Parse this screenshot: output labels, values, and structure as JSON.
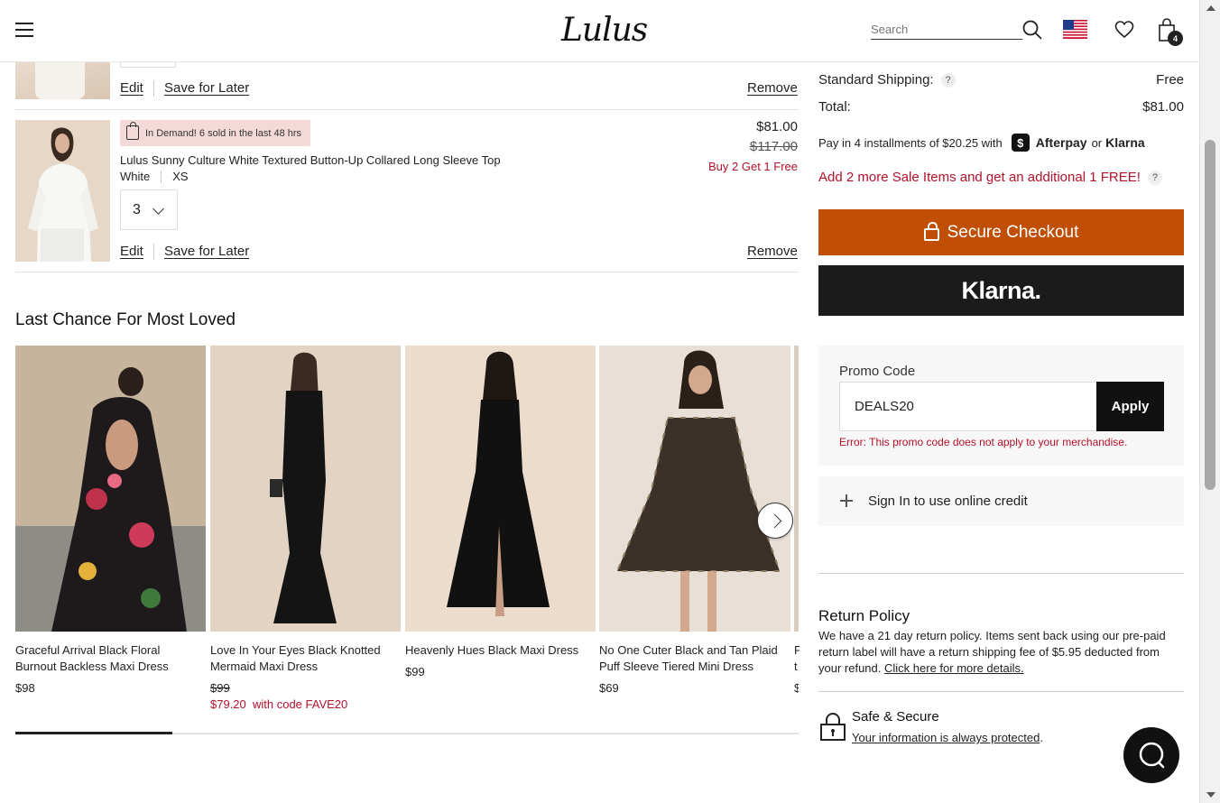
{
  "header": {
    "logo": "Lulus",
    "search_placeholder": "Search",
    "cart_count": "4"
  },
  "cart": {
    "item1": {
      "edit": "Edit",
      "save_for_later": "Save for Later",
      "remove": "Remove"
    },
    "item2": {
      "badge": "In Demand! 6 sold in the last 48 hrs",
      "name": "Lulus Sunny Culture White Textured Button-Up Collared Long Sleeve Top",
      "color": "White",
      "size": "XS",
      "quantity": "3",
      "price": "$81.00",
      "original_price": "$117.00",
      "promo": "Buy 2 Get 1 Free",
      "edit": "Edit",
      "save_for_later": "Save for Later",
      "remove": "Remove"
    }
  },
  "recommendations": {
    "title": "Last Chance For Most Loved",
    "products": [
      {
        "name": "Graceful Arrival Black Floral Burnout Backless Maxi Dress",
        "price": "$98",
        "original_price": "",
        "sale": ""
      },
      {
        "name": "Love In Your Eyes Black Knotted Mermaid Maxi Dress",
        "price": "",
        "original_price": "$99",
        "sale": "$79.20  with code FAVE20"
      },
      {
        "name": "Heavenly Hues Black Maxi Dress",
        "price": "$99",
        "original_price": "",
        "sale": ""
      },
      {
        "name": "No One Cuter Black and Tan Plaid Puff Sleeve Tiered Mini Dress",
        "price": "$69",
        "original_price": "",
        "sale": ""
      },
      {
        "name": "F t",
        "price": "$",
        "original_price": "",
        "sale": ""
      }
    ],
    "carousel_progress": 0.2
  },
  "summary": {
    "shipping_label": "Standard Shipping:",
    "shipping_value": "Free",
    "total_label": "Total:",
    "total_value": "$81.00",
    "afterpay_text": "Pay in 4 installments of $20.25 with",
    "afterpay_brand": "Afterpay",
    "or_text": "or",
    "klarna_brand": "Klarna",
    "sale_message": "Add 2 more Sale Items and get an additional 1 FREE!",
    "checkout_label": "Secure Checkout",
    "klarna_button": "Klarna.",
    "qmark": "?"
  },
  "promo": {
    "label": "Promo Code",
    "value": "DEALS20",
    "apply": "Apply",
    "error": "Error: This promo code does not apply to your merchandise."
  },
  "credit": {
    "label": "Sign In to use online credit"
  },
  "return_policy": {
    "title": "Return Policy",
    "text": "We have a 21 day return policy. Items sent back using our pre-paid return label will have a return shipping fee of $5.95 deducted from your refund. ",
    "link": "Click here for more details."
  },
  "safe": {
    "title": "Safe & Secure",
    "link": "Your information is always protected",
    "period": "."
  },
  "colors": {
    "checkout": "#c04e04",
    "sale_red": "#b2122b",
    "klarna_bg": "#1b1b1b"
  }
}
